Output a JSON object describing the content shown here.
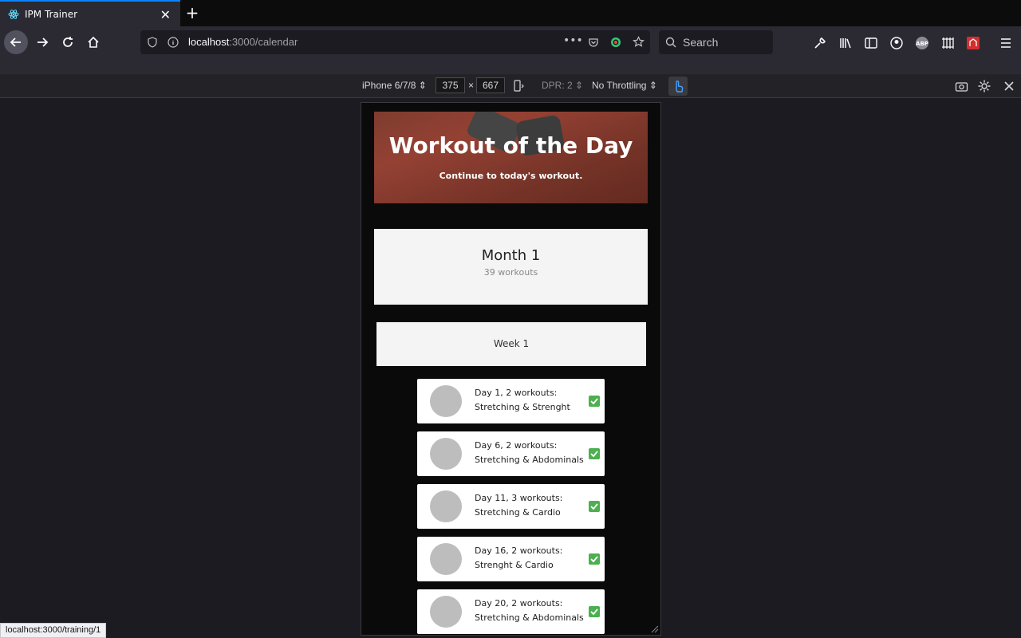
{
  "browser": {
    "tab_title": "IPM Trainer",
    "url_host": "localhost",
    "url_path": ":3000/calendar",
    "search_placeholder": "Search",
    "status_url": "localhost:3000/training/1"
  },
  "devtools": {
    "device": "iPhone 6/7/8",
    "width": "375",
    "times": "×",
    "height": "667",
    "dpr": "DPR: 2",
    "throttling": "No Throttling"
  },
  "hero": {
    "title": "Workout of the Day",
    "subtitle": "Continue to today's workout."
  },
  "month": {
    "title": "Month 1",
    "subtitle": "39 workouts"
  },
  "week": {
    "label": "Week 1"
  },
  "days": [
    {
      "line1": "Day 1, 2 workouts:",
      "line2": "Stretching & Strenght",
      "done": true
    },
    {
      "line1": "Day 6, 2 workouts:",
      "line2": "Stretching & Abdominals",
      "done": true
    },
    {
      "line1": "Day 11, 3 workouts:",
      "line2": "Stretching & Cardio",
      "done": true
    },
    {
      "line1": "Day 16, 2 workouts:",
      "line2": "Strenght & Cardio",
      "done": true
    },
    {
      "line1": "Day 20, 2 workouts:",
      "line2": "Stretching & Abdominals",
      "done": true
    }
  ],
  "colors": {
    "accent": "#0a84ff",
    "check": "#4caf50"
  }
}
